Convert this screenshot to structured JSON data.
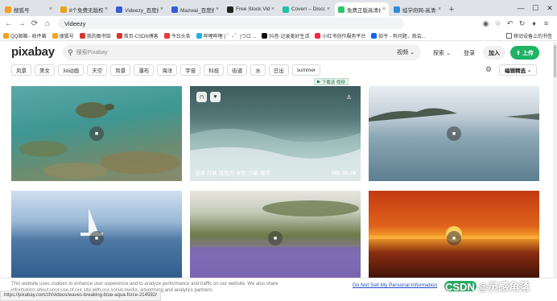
{
  "tabs": [
    {
      "title": "搜狐号",
      "color": "#f4a020",
      "active": false
    },
    {
      "title": "8个免费无版权视频网",
      "color": "#e8a316",
      "active": false
    },
    {
      "title": "Videezy_百度搜索",
      "color": "#3a5bd9",
      "active": false
    },
    {
      "title": "Mazwai_百度搜索",
      "color": "#3a5bd9",
      "active": false
    },
    {
      "title": "Free Stock Video",
      "color": "#222222",
      "active": false
    },
    {
      "title": "Coverr – Discover",
      "color": "#21c2a5",
      "active": false
    },
    {
      "title": "免费正版高清视频素材",
      "color": "#2ec66d",
      "active": true
    },
    {
      "title": "蛙学府网-高清视频",
      "color": "#2d8bd8",
      "active": false
    }
  ],
  "tab_close": "×",
  "new_tab": "+",
  "window_controls": {
    "minimize": "—",
    "maximize": "☐",
    "close": "✕"
  },
  "address": {
    "value": "Videezy"
  },
  "nav_icons": {
    "back": "←",
    "forward": "→",
    "reload": "⟳",
    "home": "⌂"
  },
  "toolbar_icons": [
    "◉",
    "☆",
    "↶",
    "↻",
    "♦",
    "≡"
  ],
  "bookmarks": [
    {
      "label": "QQ邮箱 - 收件箱",
      "color": "#f4a020"
    },
    {
      "label": "搜狐号",
      "color": "#f4a020"
    },
    {
      "label": "我的图书馆",
      "color": "#d2392b"
    },
    {
      "label": "首页-CSDN博客",
      "color": "#d2392b"
    },
    {
      "label": "今日头条",
      "color": "#e33b3b"
    },
    {
      "label": "哔哩哔哩 ( ゜- ゜)つロ ...",
      "color": "#23ade5"
    },
    {
      "label": "抖音-记录美好生活",
      "color": "#111111"
    },
    {
      "label": "小红书创作服务平台",
      "color": "#ff2442"
    },
    {
      "label": "知乎 - 有问题，就会...",
      "color": "#0a66ff"
    }
  ],
  "bookmarks_right": "移动设备上的书签",
  "pixabay": {
    "logo": "pixabay",
    "search_placeholder": "搜索Pixabay",
    "scope": "视频",
    "nav": {
      "explore": "探索",
      "login": "登录",
      "join": "加入",
      "upload": "上传"
    }
  },
  "tags": [
    "风景",
    "美女",
    "3d动画",
    "天空",
    "背景",
    "瀑布",
    "海洋",
    "宇宙",
    "科技",
    "街道",
    "水",
    "日出",
    "summer"
  ],
  "sort_label": "编辑精选",
  "download_chip": "下载该 视频 ",
  "videos": [
    {
      "title": "sea turtle reef",
      "tags": "",
      "duration": ""
    },
    {
      "title": "waves",
      "tags": "波浪  打破  蓝色的  水色  力量  海洋",
      "quality": "HD",
      "duration": "00:28"
    },
    {
      "title": "island calm sea",
      "tags": "",
      "duration": ""
    },
    {
      "title": "sailboat ocean",
      "tags": "",
      "duration": ""
    },
    {
      "title": "lavender field",
      "tags": "",
      "duration": ""
    },
    {
      "title": "sunset sea",
      "tags": "",
      "duration": ""
    }
  ],
  "cookie": {
    "text": "This website uses cookies to enhance user experience and to analyze performance and traffic on our website. We also share information about your use of our site with our social media, advertising and analytics partners.",
    "link": "Do Not Sell My Personal Information"
  },
  "status_url": "https://pixabay.com/zh/videos/waves-breaking-blue-aqua-force-214592/",
  "watermark": "CSDN @灵感角落"
}
